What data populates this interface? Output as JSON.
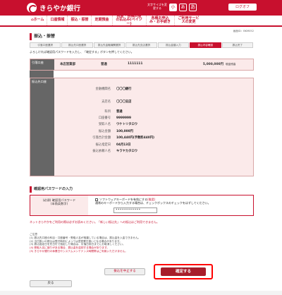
{
  "header": {
    "brand": "きらやか銀行",
    "fontsize_label": "文字サイズを変更する",
    "fontsize_small": "小",
    "fontsize_medium": "あ",
    "fontsize_large": "あ",
    "logout": "ログオフ",
    "brand_color": "#c8102e"
  },
  "nav": [
    {
      "label": "ホーム",
      "icon": "home-icon"
    },
    {
      "label": "口座情報"
    },
    {
      "label": "振込・振替"
    },
    {
      "label": "定期預金"
    },
    {
      "label": "税金・各種料金の払込み(ペイジー)"
    },
    {
      "label": "各種お申込み・お手続き"
    },
    {
      "label": "ご利用サービスの変更"
    }
  ],
  "date_line": "画面ID：BKM052",
  "page_title": "振込・振替",
  "steps": [
    "引落口座選択",
    "振込先口座選択",
    "振込先金融機関選択",
    "振込先支店選択",
    "振込金額入力",
    "振込内容確認",
    "振込完了"
  ],
  "instruction": "よろしければ確認用パスワードを入力し、「確定する」ボタンを押してください。",
  "withdraw": {
    "label": "引落口座",
    "branch": "本店営業部",
    "type": "普通",
    "number": "1111111",
    "balance": "5,000,000円",
    "balance_note": "現金残高"
  },
  "deposit": {
    "label": "振込先口座",
    "rows": [
      {
        "k": "金融機関名",
        "v": "〇〇〇銀行"
      },
      {
        "k": "支店名",
        "v": "〇〇〇支店"
      },
      {
        "k": "科目",
        "v": "普通"
      },
      {
        "k": "口座番号",
        "v": "9999999"
      },
      {
        "k": "受取人名",
        "v": "ウケトリタロウ"
      },
      {
        "k": "振込金額",
        "v": "100,000円"
      },
      {
        "k": "引落合計金額",
        "v": "100,440円(手数料440円)"
      },
      {
        "k": "振込指定日",
        "v": "04月13日"
      },
      {
        "k": "振込依頼人名",
        "v": "キラヤカタロウ"
      }
    ]
  },
  "password": {
    "section_title": "確認用パスワードの入力",
    "label": "確認用パスワード",
    "label_note": "(半角英数字)",
    "required": "(必須)",
    "checkbox_text": "ソフトウェアキーボードを有効にする",
    "checkbox_badge": "推奨",
    "checkbox_note": "通常のキーボードから入力する場合は、チェックボックスのチェックをはずしてください。",
    "value": "••••••••••••"
  },
  "caution": "ネットきらやかをご利用の際は必ずお読みください。「新しい振込先」への振込はご利用できません。",
  "notes": [
    "ご注意",
    "(1) 振込先口座の科目・口座番号・受取人名が相違している場合は、振込金を入金できません。",
    "(2) 当日扱いの振込は受付時刻によっては翌営業日扱いとなる場合があります。",
    "(3) 振込指定日を先日付で指定した場合は、引落日前日までにお取消しください。",
    "(4) 受取人名に誤りがある場合、振込金を返却する場合があります。",
    "(5) きらやか銀行の休業日やシステムメンテナンス時間帯はご利用いただけません。"
  ],
  "buttons": {
    "cancel": "振込を中止する",
    "confirm": "確定する",
    "back": "戻る"
  }
}
